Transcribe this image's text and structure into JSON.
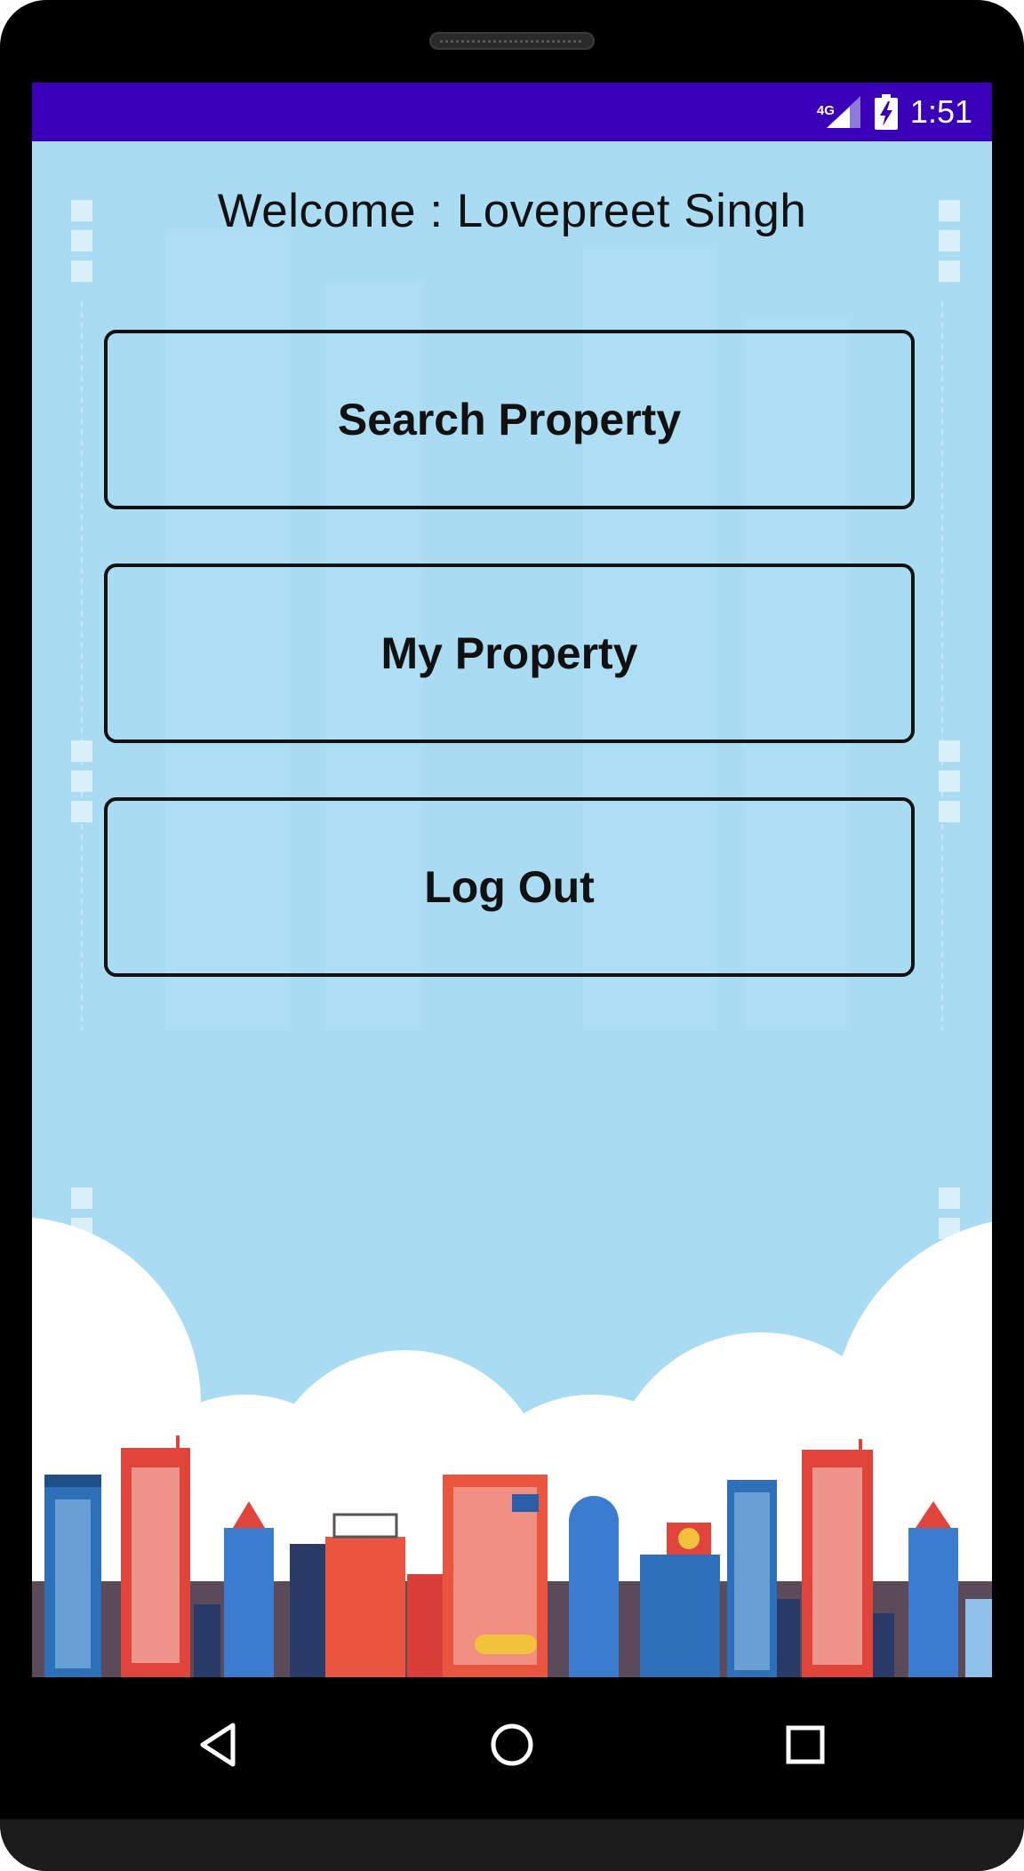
{
  "status_bar": {
    "network": "4G",
    "time": "1:51",
    "color": "#3a00b8"
  },
  "welcome": {
    "prefix": "Welcome : ",
    "user_name": "Lovepreet Singh"
  },
  "buttons": {
    "search_property": "Search Property",
    "my_property": "My Property",
    "log_out": "Log Out"
  },
  "nav_bar": {
    "back_icon": "back-triangle-icon",
    "home_icon": "home-circle-icon",
    "recents_icon": "recents-square-icon"
  },
  "colors": {
    "background": "#a9dcf2",
    "button_border": "#111111"
  }
}
